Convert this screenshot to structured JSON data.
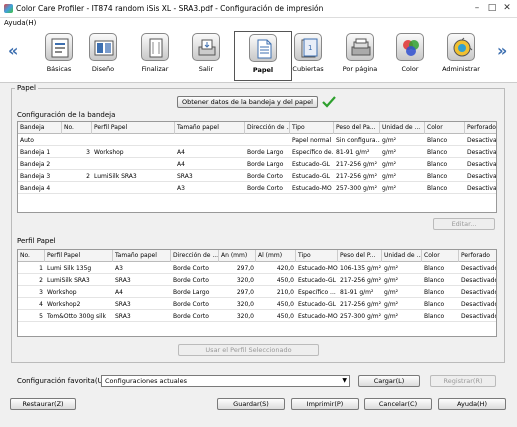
{
  "window": {
    "title": "Color Care Profiler - IT874 random iSis XL - SRA3.pdf - Configuración de impresión",
    "minimize": "–",
    "maximize": "□",
    "close": "✕"
  },
  "menu": {
    "help": "Ayuda(H)"
  },
  "toolbar": {
    "prev": "«",
    "next": "»",
    "tools": [
      {
        "label": "Básicas",
        "icon": "basics-icon"
      },
      {
        "label": "Diseño",
        "icon": "layout-icon"
      },
      {
        "label": "Finalizar",
        "icon": "finishing-icon"
      },
      {
        "label": "Salir",
        "icon": "output-icon"
      },
      {
        "label": "Papel",
        "icon": "paper-icon"
      },
      {
        "label": "Cubiertas",
        "icon": "covers-icon"
      },
      {
        "label": "Por página",
        "icon": "per-page-icon"
      },
      {
        "label": "Color",
        "icon": "color-icon"
      },
      {
        "label": "Administrar",
        "icon": "admin-icon"
      }
    ],
    "active": "Papel"
  },
  "paper_group": {
    "label": "Papel",
    "get_tray_button": "Obtener datos de la bandeja y del papel",
    "tray_section_label": "Configuración de la bandeja",
    "edit_button": "Editar...",
    "profile_section_label": "Perfil Papel",
    "use_profile_button": "Usar el Perfil Seleccionado"
  },
  "tray_table": {
    "columns": [
      "Bandeja",
      "No.",
      "Perfil Papel",
      "Tamaño papel",
      "Dirección de ...",
      "Tipo",
      "Peso del Pa...",
      "Unidad de ...",
      "Color",
      "Perforado"
    ],
    "rows": [
      [
        "Auto",
        "",
        "",
        "",
        "",
        "Papel normal",
        "Sin configura...",
        "g/m²",
        "Blanco",
        "Desactivado"
      ],
      [
        "Bandeja 1",
        "3",
        "Workshop",
        "A4",
        "Borde Largo",
        "Específico de...",
        "81-91 g/m²",
        "g/m²",
        "Blanco",
        "Desactivado"
      ],
      [
        "Bandeja 2",
        "",
        "",
        "A4",
        "Borde Largo",
        "Estucado-GL",
        "217-256 g/m²",
        "g/m²",
        "Blanco",
        "Desactivado"
      ],
      [
        "Bandeja 3",
        "2",
        "LumiSilk SRA3",
        "SRA3",
        "Borde Corto",
        "Estucado-GL",
        "217-256 g/m²",
        "g/m²",
        "Blanco",
        "Desactivado"
      ],
      [
        "Bandeja 4",
        "",
        "",
        "A3",
        "Borde Corto",
        "Estucado-MO",
        "257-300 g/m²",
        "g/m²",
        "Blanco",
        "Desactivado"
      ]
    ]
  },
  "profile_table": {
    "columns": [
      "No.",
      "Perfil Papel",
      "Tamaño papel",
      "Dirección de ...",
      "An (mm)",
      "Al (mm)",
      "Tipo",
      "Peso del P...",
      "Unidad de ...",
      "Color",
      "Perforado"
    ],
    "rows": [
      [
        "1",
        "Lumi Silk 135g",
        "A3",
        "Borde Corto",
        "297,0",
        "420,0",
        "Estucado-MO",
        "106-135 g/m²",
        "g/m²",
        "Blanco",
        "Desactivado"
      ],
      [
        "2",
        "LumiSilk SRA3",
        "SRA3",
        "Borde Corto",
        "320,0",
        "450,0",
        "Estucado-GL",
        "217-256 g/m²",
        "g/m²",
        "Blanco",
        "Desactivado"
      ],
      [
        "3",
        "Workshop",
        "A4",
        "Borde Largo",
        "297,0",
        "210,0",
        "Específico ...",
        "81-91 g/m²",
        "g/m²",
        "Blanco",
        "Desactivado"
      ],
      [
        "4",
        "Workshop2",
        "SRA3",
        "Borde Corto",
        "320,0",
        "450,0",
        "Estucado-GL",
        "217-256 g/m²",
        "g/m²",
        "Blanco",
        "Desactivado"
      ],
      [
        "5",
        "Tom&Otto 300g silk",
        "SRA3",
        "Borde Corto",
        "320,0",
        "450,0",
        "Estucado-MO",
        "257-300 g/m²",
        "g/m²",
        "Blanco",
        "Desactivado"
      ]
    ]
  },
  "favorites": {
    "label": "Configuración favorita(U)",
    "selected": "Configuraciones actuales",
    "load_button": "Cargar(L)",
    "register_button": "Registrar(R)"
  },
  "bottom_buttons": {
    "restore": "Restaurar(Z)",
    "save": "Guardar(S)",
    "print": "Imprimir(P)",
    "cancel": "Cancelar(C)",
    "help": "Ayuda(H)"
  },
  "colors": {
    "accent_blue": "#3d6fb0",
    "check_green": "#2ea02e"
  }
}
